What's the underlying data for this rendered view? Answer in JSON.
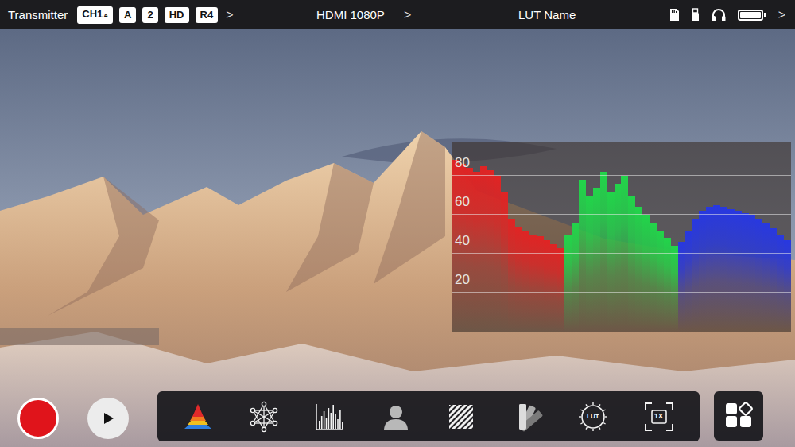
{
  "top_bar": {
    "source": "Transmitter",
    "badges": [
      {
        "text": "CH1",
        "sub": "A"
      },
      {
        "text": "A"
      },
      {
        "text": "2"
      },
      {
        "text": "HD"
      },
      {
        "text": "R4"
      }
    ],
    "badges_chevron": ">",
    "input": "HDMI 1080P",
    "input_chevron": ">",
    "lut": "LUT Name",
    "battery": {
      "level": 1.0
    },
    "status_chevron": ">"
  },
  "parade": {
    "ticks": [
      {
        "label": "80",
        "value": 80
      },
      {
        "label": "60",
        "value": 60
      },
      {
        "label": "40",
        "value": 40
      },
      {
        "label": "20",
        "value": 20
      }
    ],
    "channels": [
      {
        "color": "#e02424",
        "values": [
          88,
          86,
          84,
          82,
          85,
          83,
          80,
          72,
          58,
          54,
          52,
          50,
          49,
          47,
          45,
          43
        ]
      },
      {
        "color": "#22d44a",
        "values": [
          50,
          56,
          78,
          70,
          74,
          82,
          72,
          76,
          80,
          70,
          64,
          60,
          56,
          52,
          48,
          44
        ]
      },
      {
        "color": "#2838e0",
        "values": [
          46,
          52,
          58,
          62,
          64,
          65,
          64,
          63,
          62,
          61,
          60,
          58,
          56,
          53,
          50,
          47
        ]
      }
    ]
  },
  "toolbar": {
    "tools": [
      {
        "kind": "waveform",
        "selected": true
      },
      {
        "kind": "vectorscope",
        "selected": false
      },
      {
        "kind": "histogram",
        "selected": false
      },
      {
        "kind": "falsecolor",
        "selected": false
      },
      {
        "kind": "zebra",
        "selected": false
      },
      {
        "kind": "fan",
        "selected": false
      },
      {
        "kind": "lut",
        "label": "LUT",
        "selected": false
      },
      {
        "kind": "zoom",
        "label": "1X",
        "selected": false
      }
    ]
  }
}
